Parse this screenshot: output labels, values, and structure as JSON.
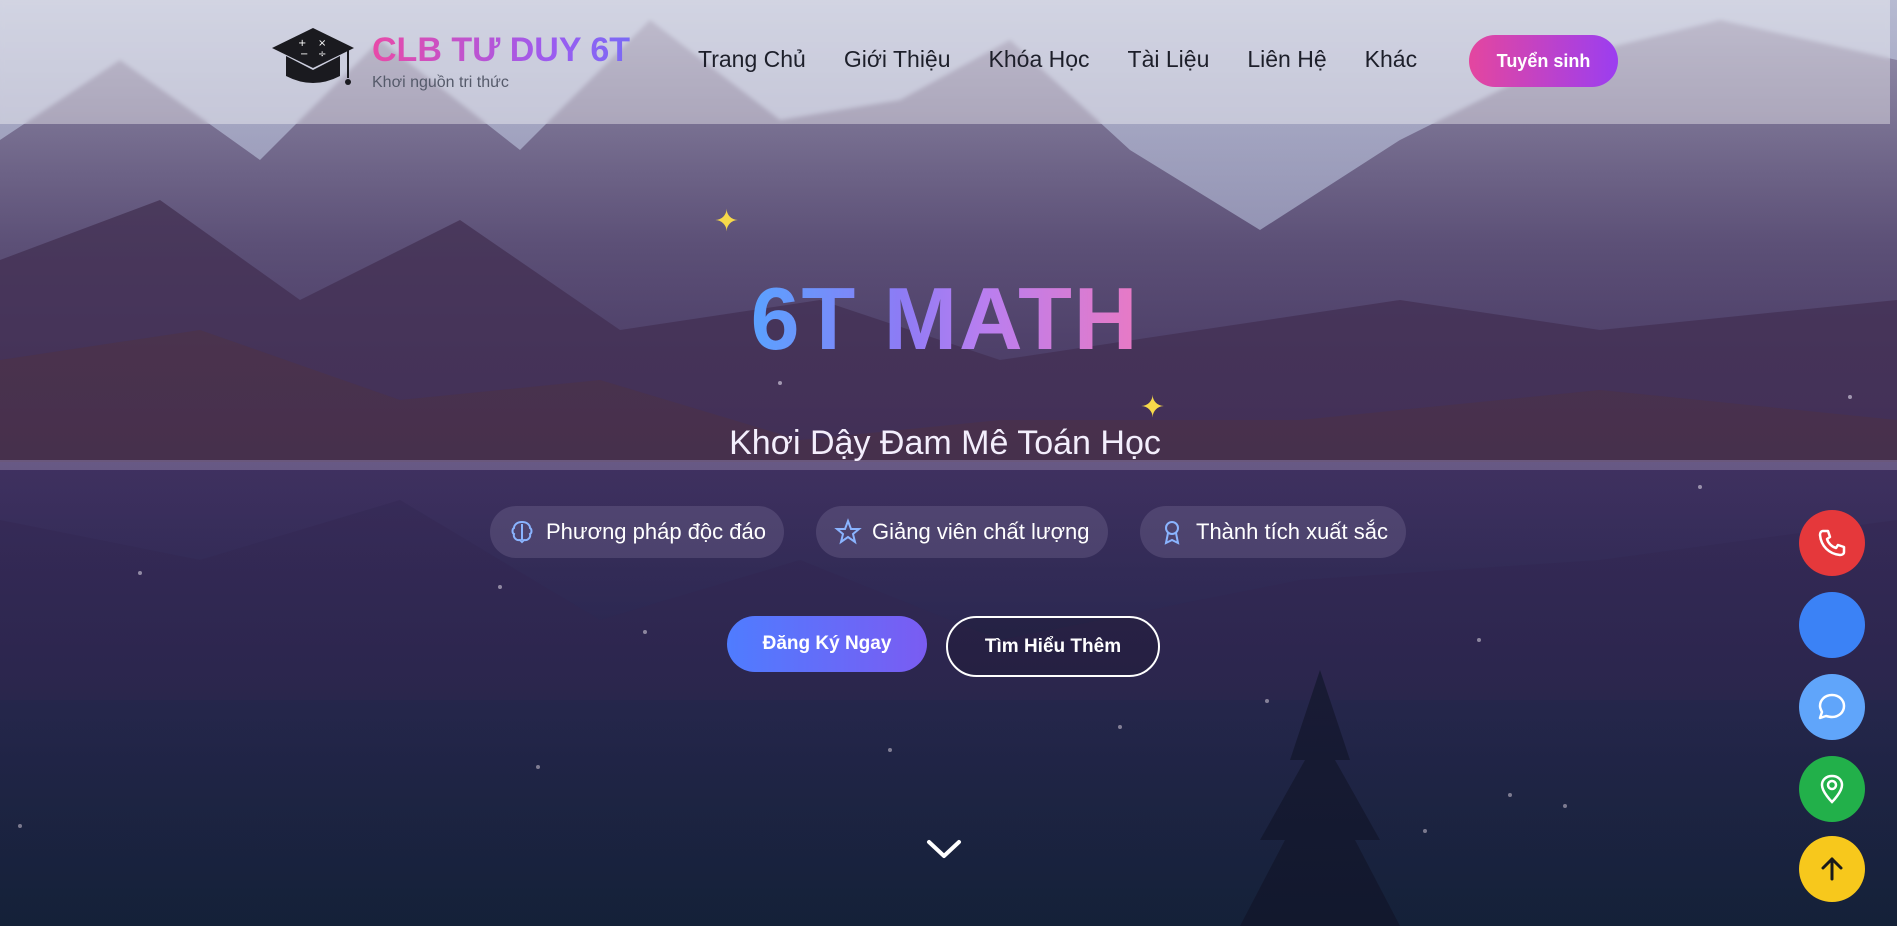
{
  "header": {
    "brand_title": "CLB TƯ DUY 6T",
    "brand_subtitle": "Khơi nguồn tri thức",
    "nav": [
      "Trang Chủ",
      "Giới Thiệu",
      "Khóa Học",
      "Tài Liệu",
      "Liên Hệ",
      "Khác"
    ],
    "cta_label": "Tuyển sinh"
  },
  "hero": {
    "title": "6T MATH",
    "subtitle": "Khơi Dậy Đam Mê Toán Học",
    "features": [
      {
        "label": "Phương pháp độc đáo",
        "icon": "brain-icon"
      },
      {
        "label": "Giảng viên chất lượng",
        "icon": "star-icon"
      },
      {
        "label": "Thành tích xuất sắc",
        "icon": "award-icon"
      }
    ],
    "primary_button": "Đăng Ký Ngay",
    "secondary_button": "Tìm Hiểu Thêm"
  },
  "floating_actions": [
    {
      "name": "phone-button",
      "icon": "phone-icon",
      "color": "#e5383b"
    },
    {
      "name": "messenger-button",
      "icon": "blank",
      "color": "#3b82f6"
    },
    {
      "name": "chat-button",
      "icon": "chat-icon",
      "color": "#60a5fa"
    },
    {
      "name": "location-button",
      "icon": "map-pin-icon",
      "color": "#22b04a"
    },
    {
      "name": "scroll-top-button",
      "icon": "arrow-up-icon",
      "color": "#f7c81c"
    }
  ],
  "colors": {
    "accent_pink": "#e4469f",
    "accent_purple": "#9b3ef0",
    "accent_blue": "#4f7cff"
  }
}
